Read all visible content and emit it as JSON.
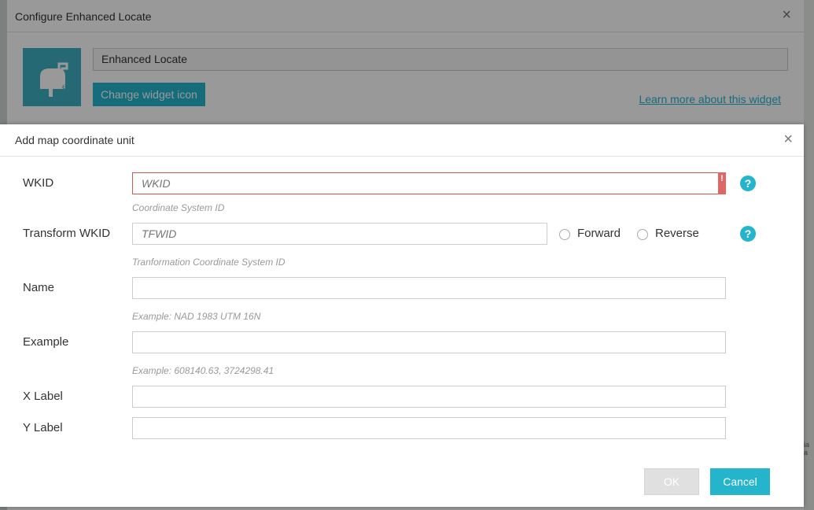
{
  "background_dialog": {
    "title": "Configure Enhanced Locate",
    "widget_name": "Enhanced Locate",
    "change_icon_label": "Change widget icon",
    "learn_more_label": "Learn more about this widget",
    "close_glyph": "×",
    "icon": "mailbox-locate-icon"
  },
  "dialog": {
    "title": "Add map coordinate unit",
    "close_glyph": "×",
    "fields": {
      "wkid": {
        "label": "WKID",
        "placeholder": "WKID",
        "value": "",
        "hint": "Coordinate System ID",
        "error_glyph": "!"
      },
      "transform_wkid": {
        "label": "Transform WKID",
        "placeholder": "TFWID",
        "value": "",
        "hint": "Tranformation Coordinate System ID"
      },
      "name": {
        "label": "Name",
        "value": "",
        "hint": "Example: NAD 1983 UTM 16N"
      },
      "example": {
        "label": "Example",
        "value": "",
        "hint": "Example: 608140.63, 3724298.41"
      },
      "x_label": {
        "label": "X Label",
        "value": ""
      },
      "y_label": {
        "label": "Y Label",
        "value": ""
      }
    },
    "radios": {
      "forward": {
        "label": "Forward",
        "checked": false
      },
      "reverse": {
        "label": "Reverse",
        "checked": false
      }
    },
    "help_glyph": "?",
    "buttons": {
      "ok": "OK",
      "cancel": "Cancel"
    }
  },
  "colors": {
    "accent": "#24b5cc",
    "error": "#d9534f",
    "disabled": "#e0e0e0"
  }
}
